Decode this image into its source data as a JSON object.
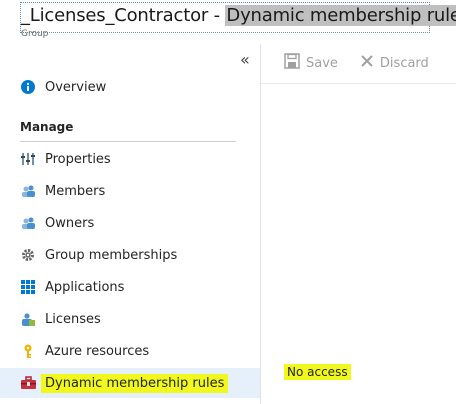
{
  "header": {
    "title_prefix": "_Licenses_Contractor - ",
    "title_highlight": "Dynamic membership rules",
    "subtitle": "Group"
  },
  "sidebar": {
    "collapse_glyph": "«",
    "overview": {
      "label": "Overview",
      "icon": "info-icon"
    },
    "section_label": "Manage",
    "items": [
      {
        "label": "Properties",
        "icon": "properties-icon"
      },
      {
        "label": "Members",
        "icon": "members-icon"
      },
      {
        "label": "Owners",
        "icon": "owners-icon"
      },
      {
        "label": "Group memberships",
        "icon": "gear-icon"
      },
      {
        "label": "Applications",
        "icon": "applications-grid-icon"
      },
      {
        "label": "Licenses",
        "icon": "license-icon"
      },
      {
        "label": "Azure resources",
        "icon": "key-icon"
      },
      {
        "label": "Dynamic membership rules",
        "icon": "toolbox-icon",
        "active": true
      }
    ]
  },
  "toolbar": {
    "save_label": "Save",
    "discard_label": "Discard"
  },
  "main": {
    "status_text": "No access"
  },
  "colors": {
    "highlight_yellow": "#f0f81e",
    "active_bg": "#e6f0fa",
    "accent_blue": "#0078d4"
  }
}
